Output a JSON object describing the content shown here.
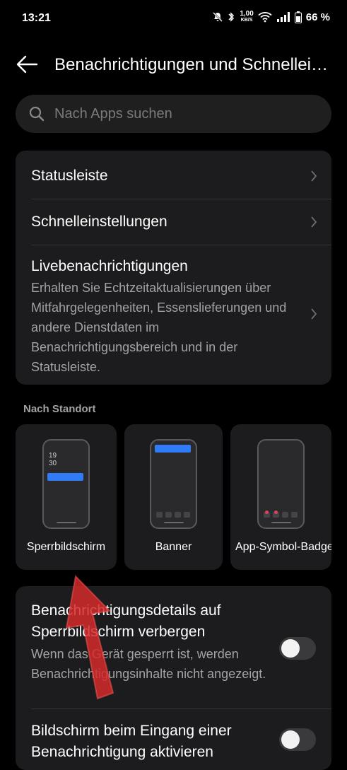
{
  "status_bar": {
    "time": "13:21",
    "net_speed": "1,00",
    "net_unit": "KB/S",
    "battery": "66 %",
    "icons": [
      "mute-bell-icon",
      "bluetooth-icon",
      "wifi-icon",
      "signal-icon",
      "battery-icon"
    ]
  },
  "header": {
    "title": "Benachrichtigungen und Schnelleinstellungen",
    "back_icon": "arrow-left-icon"
  },
  "search": {
    "placeholder": "Nach Apps suchen",
    "icon": "search-icon"
  },
  "menu": {
    "items": [
      {
        "title": "Statusleiste",
        "subtitle": ""
      },
      {
        "title": "Schnelleinstellungen",
        "subtitle": ""
      },
      {
        "title": "Livebenachrichtigungen",
        "subtitle": "Erhalten Sie Echtzeitaktualisierungen über Mitfahrgelegenheiten, Essenslieferungen und andere Dienstdaten im Benachrichtigungsbereich und in der Statusleiste."
      }
    ]
  },
  "section": {
    "label": "Nach Standort"
  },
  "tiles": [
    {
      "label": "Sperrbildschirm",
      "clock_h": "19",
      "clock_m": "30"
    },
    {
      "label": "Banner"
    },
    {
      "label": "App-Symbol-Badges"
    }
  ],
  "settings": [
    {
      "title": "Benachrichtigungsdetails auf Sperrbildschirm verbergen",
      "subtitle": "Wenn das Gerät gesperrt ist, werden Benachrichtigungsinhalte nicht angezeigt.",
      "enabled": false
    },
    {
      "title": "Bildschirm beim Eingang einer Benachrichtigung aktivieren",
      "subtitle": "",
      "enabled": false
    }
  ],
  "colors": {
    "accent": "#2f7cf6",
    "badge": "#e0405b",
    "annotation_arrow": "#d42a2a"
  }
}
